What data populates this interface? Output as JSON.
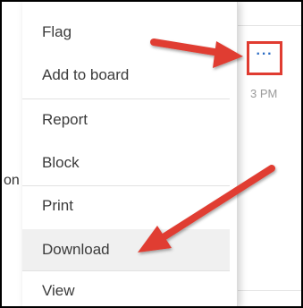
{
  "menu": {
    "items": [
      {
        "label": "Flag"
      },
      {
        "label": "Add to board"
      },
      {
        "label": "Report"
      },
      {
        "label": "Block"
      },
      {
        "label": "Print"
      },
      {
        "label": "Download"
      },
      {
        "label": "View"
      }
    ]
  },
  "message": {
    "more_button_label": "···",
    "time": "3 PM",
    "left_fragment": "on"
  },
  "colors": {
    "annotation_red": "#e03c31",
    "dots_blue": "#2b6cc4",
    "highlight_bg": "#f0f0f0"
  },
  "icons": {
    "more": "more-options-icon",
    "annotation_arrows": "red-arrow-annotation"
  }
}
